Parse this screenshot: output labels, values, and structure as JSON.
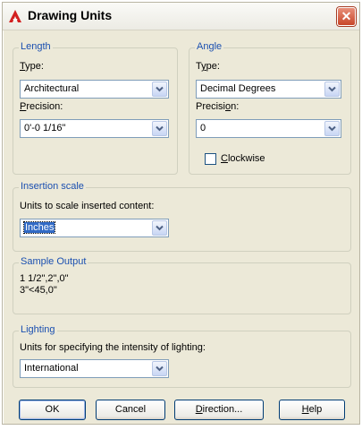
{
  "window": {
    "title": "Drawing Units",
    "close_glyph": "✕"
  },
  "length": {
    "group_label": "Length",
    "type_label": "Type:",
    "type_value": "Architectural",
    "precision_label": "Precision:",
    "precision_value": "0'-0 1/16\""
  },
  "angle": {
    "group_label": "Angle",
    "type_label": "Type:",
    "type_value": "Decimal Degrees",
    "precision_label": "Precision:",
    "precision_value": "0",
    "clockwise_label": "Clockwise",
    "clockwise_checked": false
  },
  "insertion": {
    "group_label": "Insertion scale",
    "desc": "Units to scale inserted content:",
    "value": "Inches"
  },
  "sample": {
    "group_label": "Sample Output",
    "line1": "1 1/2\",2\",0\"",
    "line2": "3\"<45,0\""
  },
  "lighting": {
    "group_label": "Lighting",
    "desc": "Units for specifying the intensity of lighting:",
    "value": "International"
  },
  "buttons": {
    "ok": "OK",
    "cancel": "Cancel",
    "direction": "Direction...",
    "help": "Help"
  },
  "colors": {
    "legend": "#1a4fb0",
    "dialog_bg": "#ece9d8",
    "close_btn": "#c8462a"
  },
  "icons": {
    "app": "autocad-a-icon",
    "dropdown": "chevron-down-icon",
    "close": "close-icon"
  }
}
